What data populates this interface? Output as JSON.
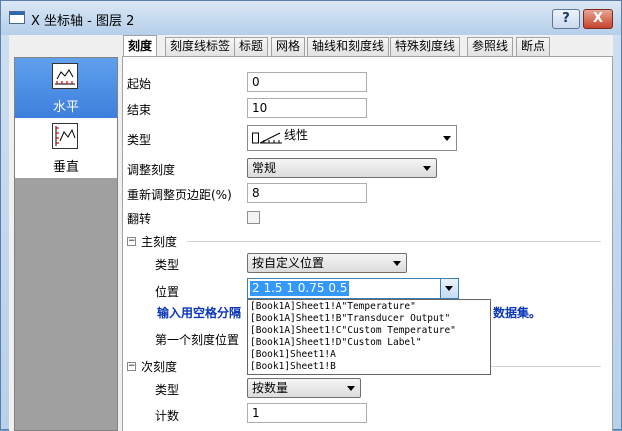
{
  "window": {
    "title": "X 坐标轴 - 图层 2",
    "help_label": "?",
    "close_label": "X"
  },
  "tabs": [
    {
      "label": "刻度",
      "active": true
    },
    {
      "label": "刻度线标签"
    },
    {
      "label": "标题"
    },
    {
      "label": "网格"
    },
    {
      "label": "轴线和刻度线"
    },
    {
      "label": "特殊刻度线"
    },
    {
      "label": "参照线"
    },
    {
      "label": "断点"
    }
  ],
  "axes_list": [
    {
      "label": "水平",
      "icon": "horizontal-axis-icon",
      "selected": true
    },
    {
      "label": "垂直",
      "icon": "vertical-axis-icon",
      "selected": false
    }
  ],
  "form": {
    "start_label": "起始",
    "start_value": "0",
    "end_label": "结束",
    "end_value": "10",
    "type_label": "类型",
    "type_value": "线性",
    "rescale_label": "调整刻度",
    "rescale_value": "常规",
    "rescale_margin_label": "重新调整页边距(%)",
    "rescale_margin_value": "8",
    "reverse_label": "翻转",
    "reverse_checked": false
  },
  "major_ticks": {
    "section_label": "主刻度",
    "collapse_glyph": "−",
    "type_label": "类型",
    "type_value": "按自定义位置",
    "position_label": "位置",
    "position_value": "2 1.5 1 0.75 0.5",
    "hint_left": "输入用空格分隔",
    "hint_right": "数据集。",
    "first_tick_label": "第一个刻度位置",
    "dropdown_options": [
      "[Book1A]Sheet1!A\"Temperature\"",
      "[Book1A]Sheet1!B\"Transducer Output\"",
      "[Book1A]Sheet1!C\"Custom Temperature\"",
      "[Book1A]Sheet1!D\"Custom Label\"",
      "[Book1]Sheet1!A",
      "[Book1]Sheet1!B"
    ]
  },
  "minor_ticks": {
    "section_label": "次刻度",
    "collapse_glyph": "−",
    "type_label": "类型",
    "type_value": "按数量",
    "count_label": "计数",
    "count_value": "1"
  }
}
